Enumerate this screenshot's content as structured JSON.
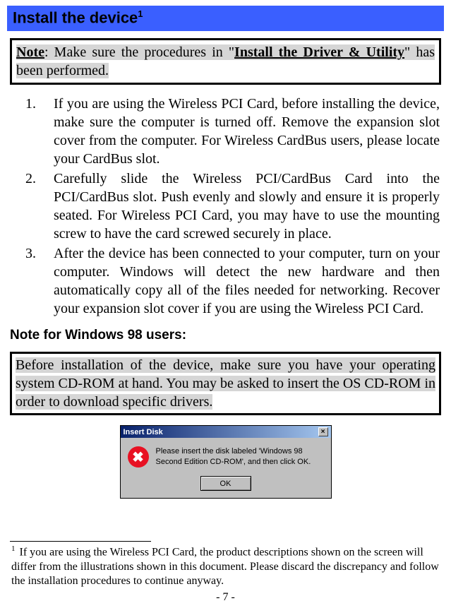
{
  "header": {
    "title": "Install the device",
    "footnote_ref": "1"
  },
  "note1": {
    "prefix": "Note",
    "colon_text": ": Make sure the procedures in \"",
    "link_text": "Install the Driver & Utility",
    "suffix": "\" has been performed."
  },
  "steps": [
    {
      "num": "1.",
      "text": "If you are using the Wireless PCI Card, before installing the device, make sure the computer is turned off. Remove the expansion slot cover from the computer. For Wireless CardBus users, please locate your CardBus slot."
    },
    {
      "num": "2.",
      "text": "Carefully slide the Wireless PCI/CardBus Card into the PCI/CardBus slot. Push evenly and slowly and ensure it is properly seated. For Wireless PCI Card, you may have to use the mounting screw to have the card screwed securely in place."
    },
    {
      "num": "3.",
      "text": "After the device has been connected to your computer, turn on your computer. Windows will detect the new hardware and then automatically copy all of the files needed for networking. Recover your expansion slot cover if you are using the Wireless PCI Card."
    }
  ],
  "subheading": "Note for Windows 98 users:",
  "note2": {
    "text": "Before installation of the device, make sure you have your operating system CD-ROM at hand. You may be asked to insert the OS CD-ROM in order to download specific drivers."
  },
  "dialog": {
    "title": "Insert Disk",
    "close_glyph": "×",
    "icon_glyph": "✖",
    "message": "Please insert the disk labeled 'Windows 98 Second Edition CD-ROM', and then click OK.",
    "ok_label": "OK"
  },
  "footnote": {
    "num": "1",
    "text": "If you are using the Wireless PCI Card, the product descriptions shown on the screen will differ from the illustrations shown in this document. Please discard the discrepancy and follow the installation procedures to continue anyway."
  },
  "page_number": "- 7 -"
}
